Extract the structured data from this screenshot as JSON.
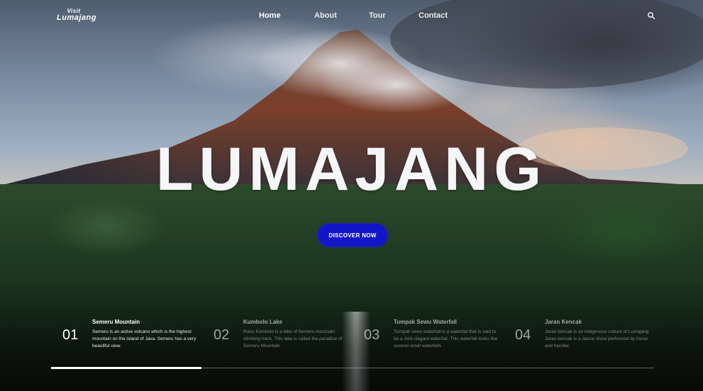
{
  "brand": {
    "logo_line1": "Visit",
    "logo_line2": "Lumajang"
  },
  "nav": {
    "items": [
      {
        "label": "Home",
        "active": true
      },
      {
        "label": "About",
        "active": false
      },
      {
        "label": "Tour",
        "active": false
      },
      {
        "label": "Contact",
        "active": false
      }
    ],
    "search_icon": "search-icon"
  },
  "hero": {
    "title": "LUMAJANG",
    "cta_label": "DISCOVER NOW",
    "cta_color": "#1316c8"
  },
  "slides": [
    {
      "num": "01",
      "title": "Semeru Mountain",
      "desc": "Semeru is an active volcano which is the highest mountain on the island of Java. Semeru has a very beautiful view.",
      "active": true
    },
    {
      "num": "02",
      "title": "Kumbolo Lake",
      "desc": "Ranu Kumbolo is a lake of Semeru mountain climbing track. This lake is called the paradise of Semeru Mountain.",
      "active": false
    },
    {
      "num": "03",
      "title": "Tumpak Sewu Waterfall",
      "desc": "Tumpak sewu waterfall is a waterfall that is said to be a mini niagara waterfall. This waterfall looks like several small waterfalls",
      "active": false
    },
    {
      "num": "04",
      "title": "Jaran Kencak",
      "desc": "Jaran kencak is an indigenous culture of Lumajang. Jaran kencak is a dance show performed by horse and handler.",
      "active": false
    }
  ],
  "progress": {
    "current": 1,
    "total": 4
  }
}
